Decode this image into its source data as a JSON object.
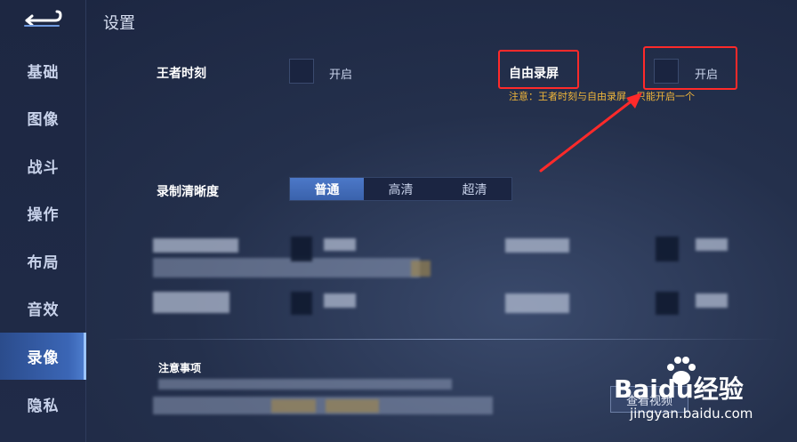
{
  "header": {
    "title": "设置"
  },
  "sidebar": {
    "items": [
      {
        "label": "基础"
      },
      {
        "label": "图像"
      },
      {
        "label": "战斗"
      },
      {
        "label": "操作"
      },
      {
        "label": "布局"
      },
      {
        "label": "音效"
      },
      {
        "label": "录像",
        "active": true
      },
      {
        "label": "隐私"
      }
    ]
  },
  "settings": {
    "highlight_moment": {
      "label": "王者时刻",
      "toggle_label": "开启"
    },
    "free_recording": {
      "label": "自由录屏",
      "toggle_label": "开启"
    },
    "note": "注意：王者时刻与自由录屏，只能开启一个",
    "quality": {
      "label": "录制清晰度",
      "options": [
        "普通",
        "高清",
        "超清"
      ],
      "selected": "普通"
    }
  },
  "notice": {
    "title": "注意事项",
    "button_label": "查看视频"
  },
  "watermark": {
    "brand": "Baidu经验",
    "url": "jingyan.baidu.com"
  },
  "colors": {
    "accent": "#3b66b6",
    "annotation_red": "#ff2a2a",
    "note_yellow": "#f0b63a"
  }
}
